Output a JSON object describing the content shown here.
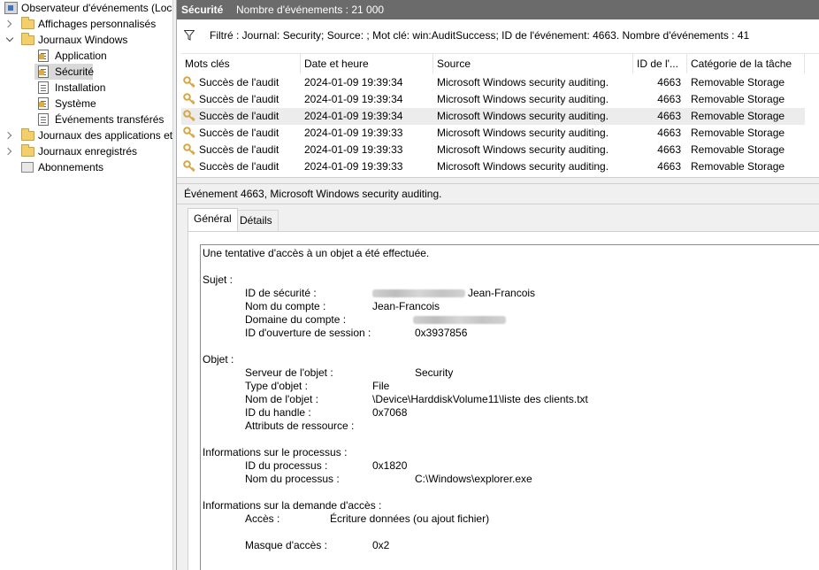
{
  "tree": {
    "root": "Observateur d'événements (Loca",
    "custom_views": "Affichages personnalisés",
    "windows_logs": "Journaux Windows",
    "application": "Application",
    "security": "Sécurité",
    "setup": "Installation",
    "system": "Système",
    "forwarded": "Événements transférés",
    "apps_services": "Journaux des applications et",
    "saved_logs": "Journaux enregistrés",
    "subscriptions": "Abonnements"
  },
  "header": {
    "log_name": "Sécurité",
    "event_count": "Nombre d'événements : 21 000"
  },
  "filter": {
    "text": "Filtré : Journal: Security; Source: ; Mot clé: win:AuditSuccess; ID de l'événement: 4663. Nombre d'événements : 41"
  },
  "grid": {
    "columns": [
      "Mots clés",
      "Date et heure",
      "Source",
      "ID de l'...",
      "Catégorie de la tâche"
    ],
    "rows": [
      {
        "keyword": "Succès de l'audit",
        "date": "2024-01-09 19:39:34",
        "source": "Microsoft Windows security auditing.",
        "id": "4663",
        "category": "Removable Storage"
      },
      {
        "keyword": "Succès de l'audit",
        "date": "2024-01-09 19:39:34",
        "source": "Microsoft Windows security auditing.",
        "id": "4663",
        "category": "Removable Storage"
      },
      {
        "keyword": "Succès de l'audit",
        "date": "2024-01-09 19:39:34",
        "source": "Microsoft Windows security auditing.",
        "id": "4663",
        "category": "Removable Storage"
      },
      {
        "keyword": "Succès de l'audit",
        "date": "2024-01-09 19:39:33",
        "source": "Microsoft Windows security auditing.",
        "id": "4663",
        "category": "Removable Storage"
      },
      {
        "keyword": "Succès de l'audit",
        "date": "2024-01-09 19:39:33",
        "source": "Microsoft Windows security auditing.",
        "id": "4663",
        "category": "Removable Storage"
      },
      {
        "keyword": "Succès de l'audit",
        "date": "2024-01-09 19:39:33",
        "source": "Microsoft Windows security auditing.",
        "id": "4663",
        "category": "Removable Storage"
      }
    ]
  },
  "detail": {
    "title": "Événement 4663, Microsoft Windows security auditing.",
    "tabs": [
      "Général",
      "Détails"
    ],
    "message": {
      "intro": "Une tentative d'accès à un objet a été effectuée.",
      "subject_header": "Sujet :",
      "subject_sid_label": "ID de sécurité :",
      "subject_sid_value": "Jean-Francois",
      "subject_account_label": "Nom du compte :",
      "subject_account_value": "Jean-Francois",
      "subject_domain_label": "Domaine du compte :",
      "subject_logon_label": "ID d'ouverture de session :",
      "subject_logon_value": "0x3937856",
      "object_header": "Objet :",
      "object_server_label": "Serveur de l'objet :",
      "object_server_value": "Security",
      "object_type_label": "Type d'objet :",
      "object_type_value": "File",
      "object_name_label": "Nom de l'objet :",
      "object_name_value": "\\Device\\HarddiskVolume11\\liste des clients.txt",
      "object_handle_label": "ID du handle :",
      "object_handle_value": "0x7068",
      "object_attr_label": "Attributs de ressource :",
      "process_header": "Informations sur le processus :",
      "process_id_label": "ID du processus :",
      "process_id_value": "0x1820",
      "process_name_label": "Nom du processus :",
      "process_name_value": "C:\\Windows\\explorer.exe",
      "access_header": "Informations sur la demande d'accès :",
      "access_label": "Accès :",
      "access_value": "Écriture données (ou ajout fichier)",
      "mask_label": "Masque d'accès :",
      "mask_value": "0x2"
    }
  },
  "colors": {
    "title_bar": "#6b6b6b",
    "selection": "#d9d9d9",
    "row_highlight": "#ececec",
    "key_icon": "#d9a441"
  }
}
